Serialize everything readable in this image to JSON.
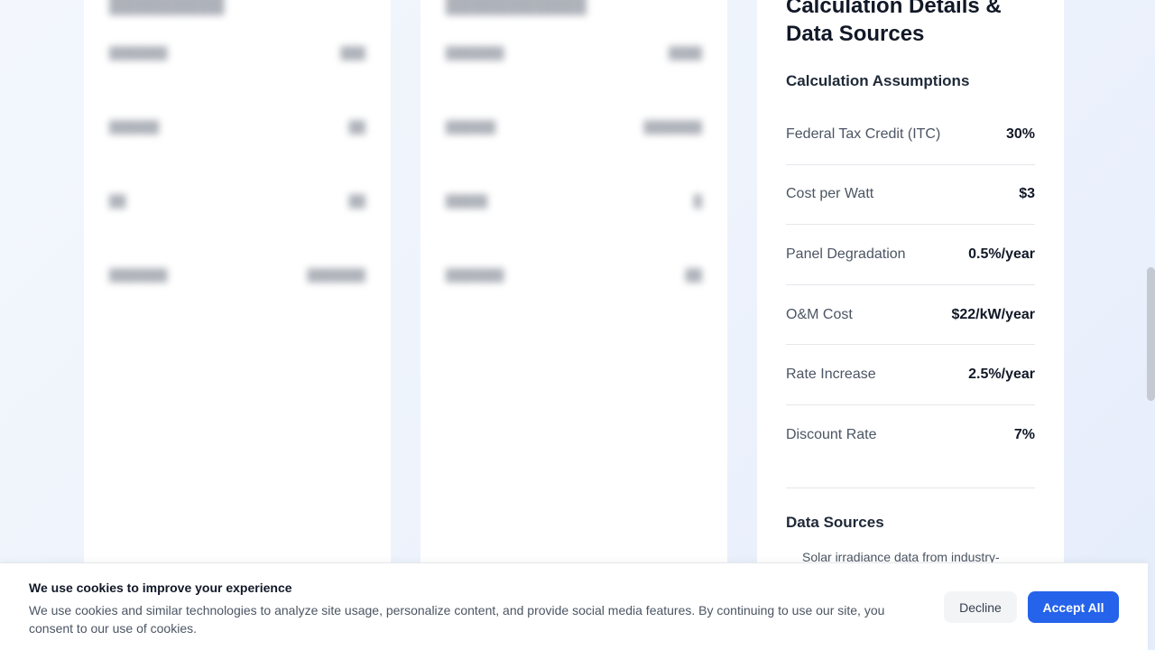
{
  "calc_panel": {
    "title": "Calculation Details & Data Sources",
    "assumptions_title": "Calculation Assumptions",
    "assumptions": [
      {
        "label": "Federal Tax Credit (ITC)",
        "value": "30%"
      },
      {
        "label": "Cost per Watt",
        "value": "$3"
      },
      {
        "label": "Panel Degradation",
        "value": "0.5%/year"
      },
      {
        "label": "O&M Cost",
        "value": "$22/kW/year"
      },
      {
        "label": "Rate Increase",
        "value": "2.5%/year"
      },
      {
        "label": "Discount Rate",
        "value": "7%"
      }
    ],
    "sources_title": "Data Sources",
    "sources": [
      "Solar irradiance data from industry-"
    ]
  },
  "cookie_banner": {
    "title": "We use cookies to improve your experience",
    "text": "We use cookies and similar technologies to analyze site usage, personalize content, and provide social media features. By continuing to use our site, you consent to our use of cookies.",
    "decline_label": "Decline",
    "accept_label": "Accept All"
  },
  "colors": {
    "accent": "#2563eb",
    "bullet": "#3b82f6"
  }
}
